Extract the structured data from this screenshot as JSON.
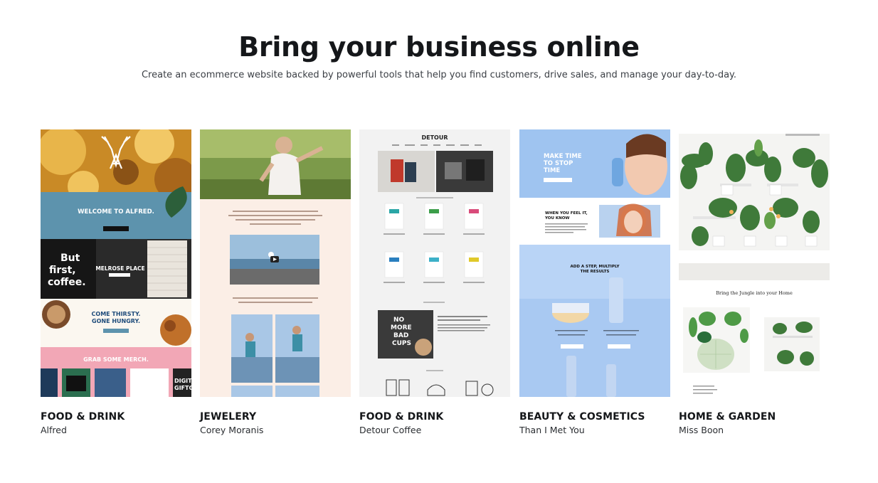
{
  "hero": {
    "title": "Bring your business online",
    "subtitle": "Create an ecommerce website backed by powerful tools that help you find customers, drive sales, and manage your day-to-day."
  },
  "cards": [
    {
      "category": "FOOD & DRINK",
      "name": "Alfred",
      "preview": {
        "welcome": "WELCOME TO ALFRED.",
        "sign_line1": "But",
        "sign_line2": "first,",
        "sign_line3": "coffee.",
        "melrose": "MELROSE PLACE",
        "thirsty_line1": "COME THIRSTY.",
        "thirsty_line2": "GONE HUNGRY.",
        "merch": "GRAB SOME MERCH.",
        "gift_line1": "DIGIT",
        "gift_line2": "GIFTC"
      }
    },
    {
      "category": "JEWELERY",
      "name": "Corey Moranis",
      "preview": {}
    },
    {
      "category": "FOOD & DRINK",
      "name": "Detour Coffee",
      "preview": {
        "logo": "DETOUR",
        "cups_line1": "NO",
        "cups_line2": "MORE",
        "cups_line3": "BAD",
        "cups_line4": "CUPS"
      }
    },
    {
      "category": "BEAUTY & COSMETICS",
      "name": "Than I Met You",
      "preview": {
        "hero_line1": "MAKE TIME",
        "hero_line2": "TO STOP",
        "hero_line3": "TIME",
        "feel_line1": "WHEN YOU FEEL IT,",
        "feel_line2": "YOU KNOW",
        "step_line1": "ADD A STEP, MULTIPLY",
        "step_line2": "THE RESULTS"
      }
    },
    {
      "category": "HOME & GARDEN",
      "name": "Miss Boon",
      "preview": {
        "tagline": "Bring the Jungle into your Home"
      }
    }
  ],
  "colors": {
    "heading": "#15171a",
    "alfred_gold": "#d49a2a",
    "alfred_blue": "#5d93ad",
    "alfred_pink": "#f2a7b6",
    "corey_peach": "#fbeee6",
    "corey_sky": "#a9c7e6",
    "detour_bg": "#f2f2f2",
    "beauty_blue": "#a9c9f2",
    "garden_white": "#f4f4f2",
    "garden_green": "#3f7a3a"
  },
  "icons": [
    "antler-logo-icon",
    "play-icon",
    "monstera-leaf-icon"
  ]
}
